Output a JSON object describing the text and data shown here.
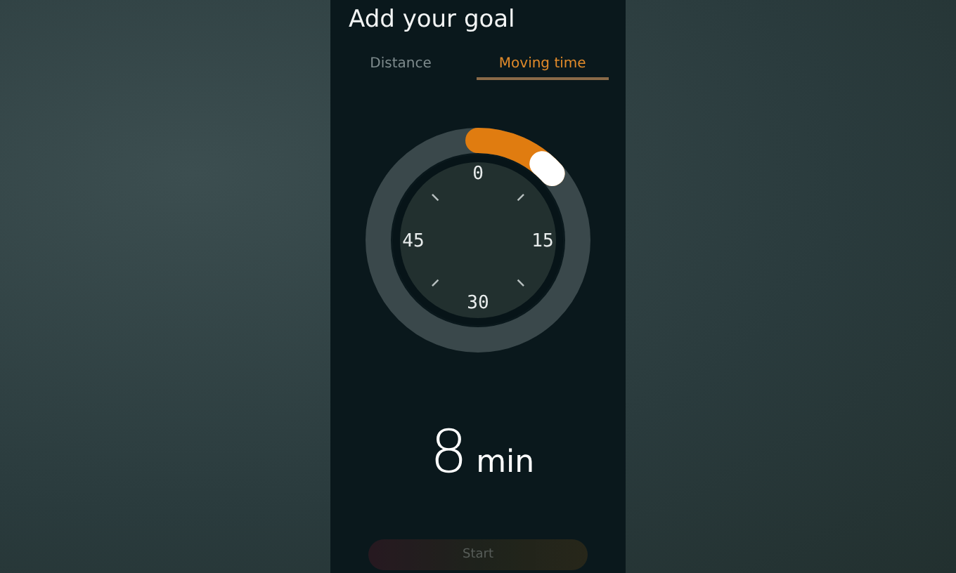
{
  "title": "Add your goal",
  "tabs": [
    {
      "label": "Distance",
      "selected": false
    },
    {
      "label": "Moving time",
      "selected": true
    }
  ],
  "dial": {
    "labels": [
      "0",
      "15",
      "30",
      "45"
    ]
  },
  "value": {
    "number": "8",
    "unit": "min"
  },
  "start_button": {
    "label": "Start",
    "disabled": true
  }
}
